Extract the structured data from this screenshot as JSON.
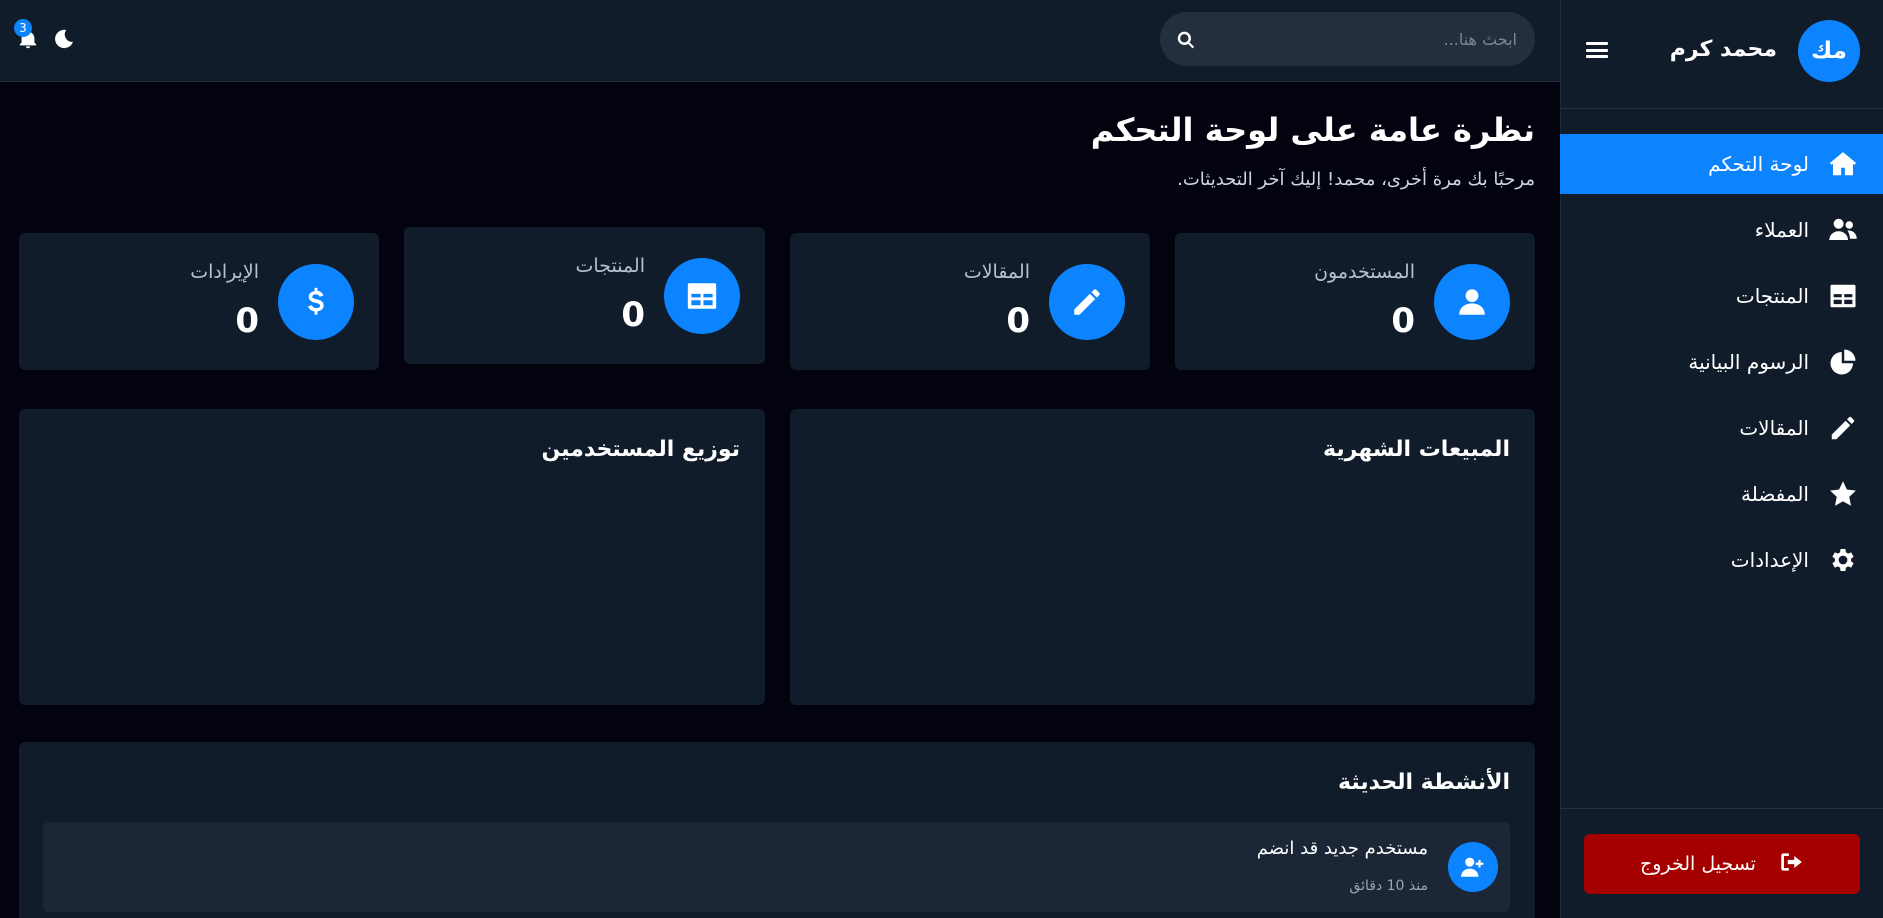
{
  "user": {
    "initials": "مك",
    "name": "محمد كرم"
  },
  "sidebar": {
    "items": [
      {
        "label": "لوحة التحكم",
        "icon": "home-icon",
        "active": true
      },
      {
        "label": "العملاء",
        "icon": "users-icon",
        "active": false
      },
      {
        "label": "المنتجات",
        "icon": "table-icon",
        "active": false
      },
      {
        "label": "الرسوم البيانية",
        "icon": "pie-chart-icon",
        "active": false
      },
      {
        "label": "المقالات",
        "icon": "pencil-icon",
        "active": false
      },
      {
        "label": "المفضلة",
        "icon": "star-icon",
        "active": false
      },
      {
        "label": "الإعدادات",
        "icon": "gear-icon",
        "active": false
      }
    ],
    "logout_label": "تسجيل الخروج"
  },
  "topbar": {
    "search_placeholder": "ابحث هنا...",
    "notification_count": "3"
  },
  "main": {
    "title": "نظرة عامة على لوحة التحكم",
    "subtitle": "مرحبًا بك مرة أخرى، محمد! إليك آخر التحديثات."
  },
  "stats": [
    {
      "label": "المستخدمون",
      "value": "0",
      "icon": "user-icon"
    },
    {
      "label": "المقالات",
      "value": "0",
      "icon": "pencil-icon"
    },
    {
      "label": "المنتجات",
      "value": "0",
      "icon": "table-icon"
    },
    {
      "label": "الإيرادات",
      "value": "0",
      "icon": "dollar-icon"
    }
  ],
  "panels": {
    "monthly_sales_title": "المبيعات الشهرية",
    "user_distribution_title": "توزيع المستخدمين"
  },
  "activities": {
    "title": "الأنشطة الحديثة",
    "items": [
      {
        "title": "مستخدم جديد قد انضم",
        "time": "منذ 10 دقائق",
        "icon": "user-plus-icon"
      }
    ]
  },
  "colors": {
    "accent": "#0d84ff",
    "logout": "#a40000",
    "background": "#02030f",
    "surface": "#111c2b"
  }
}
